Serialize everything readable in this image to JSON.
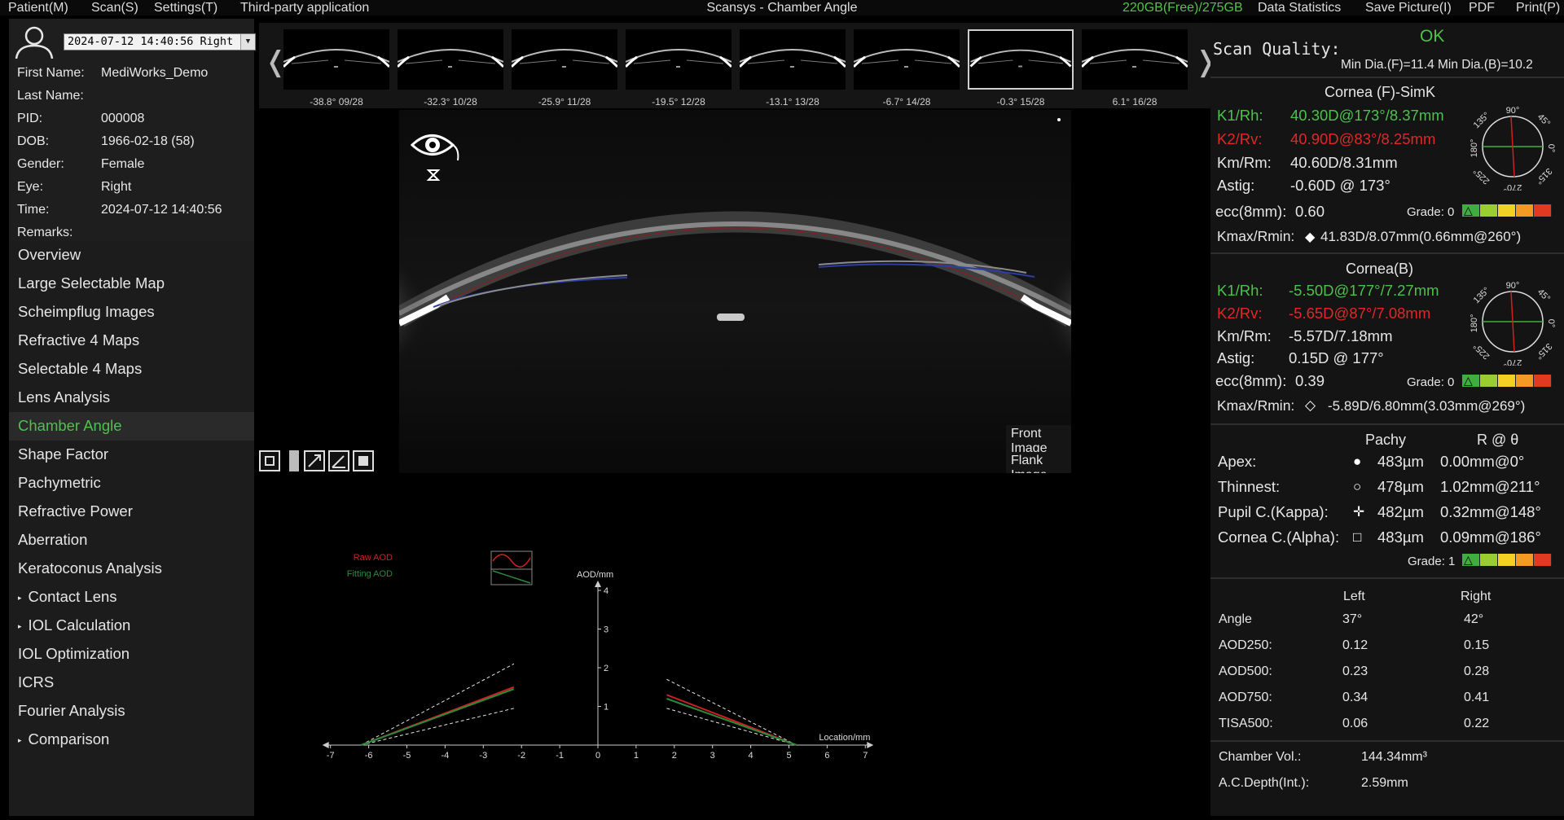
{
  "menu": {
    "patient": "Patient(M)",
    "scan": "Scan(S)",
    "settings": "Settings(T)",
    "third_party": "Third-party application",
    "window_title": "Scansys - Chamber Angle",
    "disk": "220GB(Free)/275GB",
    "data_statistics": "Data Statistics",
    "save_picture": "Save Picture(I)",
    "pdf": "PDF",
    "print": "Print(P)"
  },
  "patient": {
    "scan_select": "2024-07-12 14:40:56 Right",
    "rows": [
      {
        "label": "First Name:",
        "value": "MediWorks_Demo"
      },
      {
        "label": "Last Name:",
        "value": ""
      },
      {
        "label": "PID:",
        "value": "000008"
      },
      {
        "label": "DOB:",
        "value": "1966-02-18  (58)"
      },
      {
        "label": "Gender:",
        "value": "Female"
      },
      {
        "label": "Eye:",
        "value": "Right"
      },
      {
        "label": "Time:",
        "value": "2024-07-12 14:40:56"
      },
      {
        "label": "Remarks:",
        "value": ""
      }
    ]
  },
  "nav": [
    {
      "label": "Overview",
      "sub": false,
      "active": false
    },
    {
      "label": "Large Selectable Map",
      "sub": false,
      "active": false
    },
    {
      "label": "Scheimpflug Images",
      "sub": false,
      "active": false
    },
    {
      "label": "Refractive 4 Maps",
      "sub": false,
      "active": false
    },
    {
      "label": "Selectable 4 Maps",
      "sub": false,
      "active": false
    },
    {
      "label": "Lens Analysis",
      "sub": false,
      "active": false
    },
    {
      "label": "Chamber Angle",
      "sub": false,
      "active": true
    },
    {
      "label": "Shape Factor",
      "sub": false,
      "active": false
    },
    {
      "label": "Pachymetric",
      "sub": false,
      "active": false
    },
    {
      "label": "Refractive Power",
      "sub": false,
      "active": false
    },
    {
      "label": "Aberration",
      "sub": false,
      "active": false
    },
    {
      "label": "Keratoconus Analysis",
      "sub": false,
      "active": false
    },
    {
      "label": "Contact Lens",
      "sub": true,
      "active": false
    },
    {
      "label": "IOL Calculation",
      "sub": true,
      "active": false
    },
    {
      "label": "IOL Optimization",
      "sub": false,
      "active": false
    },
    {
      "label": "ICRS",
      "sub": false,
      "active": false
    },
    {
      "label": "Fourier Analysis",
      "sub": false,
      "active": false
    },
    {
      "label": "Comparison",
      "sub": true,
      "active": false
    }
  ],
  "thumbnails": [
    {
      "label": "-38.8° 09/28",
      "selected": false
    },
    {
      "label": "-32.3° 10/28",
      "selected": false
    },
    {
      "label": "-25.9° 11/28",
      "selected": false
    },
    {
      "label": "-19.5° 12/28",
      "selected": false
    },
    {
      "label": "-13.1° 13/28",
      "selected": false
    },
    {
      "label": "-6.7°  14/28",
      "selected": false
    },
    {
      "label": "-0.3°  15/28",
      "selected": true
    },
    {
      "label": "6.1°   16/28",
      "selected": false
    }
  ],
  "image": {
    "front_image": "Front Image",
    "flank_image": "Flank Image",
    "front_selected": false,
    "flank_selected": true
  },
  "chart_data": {
    "type": "line",
    "ylabel": "AOD/mm",
    "xlabel": "Location/mm",
    "xlim": [
      -7,
      7
    ],
    "ylim": [
      0,
      4
    ],
    "x_ticks": [
      "-7",
      "-6",
      "-5",
      "-4",
      "-3",
      "-2",
      "-1",
      "0",
      "1",
      "2",
      "3",
      "4",
      "5",
      "6",
      "7"
    ],
    "y_ticks": [
      "1",
      "2",
      "3",
      "4"
    ],
    "legend": [
      {
        "name": "Raw AOD",
        "color": "#d02020"
      },
      {
        "name": "Fitting AOD",
        "color": "#2a8a3a"
      }
    ],
    "series": [
      {
        "name": "Raw AOD",
        "side": "left",
        "x": [
          -6.2,
          -2.2
        ],
        "y": [
          0.0,
          1.5
        ]
      },
      {
        "name": "Fitting AOD",
        "side": "left",
        "x": [
          -6.2,
          -2.2
        ],
        "y": [
          0.0,
          1.45
        ]
      },
      {
        "name": "Raw AOD",
        "side": "right",
        "x": [
          1.8,
          5.2
        ],
        "y": [
          1.3,
          0.0
        ]
      },
      {
        "name": "Fitting AOD",
        "side": "right",
        "x": [
          1.8,
          5.2
        ],
        "y": [
          1.2,
          0.0
        ]
      }
    ],
    "bounds": [
      {
        "side": "left",
        "x": [
          -6.2,
          -2.2
        ],
        "y_upper": [
          0.0,
          2.1
        ],
        "y_lower": [
          0.0,
          0.95
        ]
      },
      {
        "side": "right",
        "x": [
          1.8,
          5.2
        ],
        "y_upper": [
          1.7,
          0.0
        ],
        "y_lower": [
          0.95,
          0.0
        ]
      }
    ]
  },
  "right": {
    "scan_quality_label": "Scan Quality:",
    "scan_quality_value": "OK",
    "min_dia": "Min Dia.(F)=11.4  Min Dia.(B)=10.2",
    "cornea_f_title": "Cornea (F)-SimK",
    "cornea_f": {
      "k1_label": "K1/Rh:",
      "k1": "40.30D@173°/8.37mm",
      "k2_label": "K2/Rv:",
      "k2": "40.90D@83°/8.25mm",
      "km_label": "Km/Rm:",
      "km": "40.60D/8.31mm",
      "astig_label": "Astig:",
      "astig": "-0.60D @ 173°",
      "ecc_label": "ecc(8mm):",
      "ecc": "0.60",
      "grade": "Grade: 0",
      "kmax_label": "Kmax/Rmin:",
      "kmax": "41.83D/8.07mm(0.66mm@260°)"
    },
    "cornea_b_title": "Cornea(B)",
    "cornea_b": {
      "k1_label": "K1/Rh:",
      "k1": "-5.50D@177°/7.27mm",
      "k2_label": "K2/Rv:",
      "k2": "-5.65D@87°/7.08mm",
      "km_label": "Km/Rm:",
      "km": "-5.57D/7.18mm",
      "astig_label": "Astig:",
      "astig": "0.15D @ 177°",
      "ecc_label": "ecc(8mm):",
      "ecc": "0.39",
      "grade": "Grade: 0",
      "kmax_label": "Kmax/Rmin:",
      "kmax": "-5.89D/6.80mm(3.03mm@269°)"
    },
    "dial_labels": {
      "d90": "90°",
      "d45": "45°",
      "d0": "0°",
      "d315": "315°",
      "d270": "270°",
      "d225": "225°",
      "d180": "180°",
      "d135": "135°"
    },
    "pachy_header": "Pachy",
    "r_header": "R @ θ",
    "pachy_rows": [
      {
        "label": "Apex:",
        "pachy": "483µm",
        "r": "0.00mm@0°",
        "symbol": "dot"
      },
      {
        "label": "Thinnest:",
        "pachy": "478µm",
        "r": "1.02mm@211°",
        "symbol": "circle"
      },
      {
        "label": "Pupil C.(Kappa):",
        "pachy": "482µm",
        "r": "0.32mm@148°",
        "symbol": "cross"
      },
      {
        "label": "Cornea C.(Alpha):",
        "pachy": "483µm",
        "r": "0.09mm@186°",
        "symbol": "square"
      }
    ],
    "pachy_grade": "Grade: 1",
    "angle_header_left": "Left",
    "angle_header_right": "Right",
    "angle_rows": [
      {
        "label": "Angle",
        "left": "37°",
        "right": "42°"
      },
      {
        "label": "AOD250:",
        "left": "0.12",
        "right": "0.15"
      },
      {
        "label": "AOD500:",
        "left": "0.23",
        "right": "0.28"
      },
      {
        "label": "AOD750:",
        "left": "0.34",
        "right": "0.41"
      },
      {
        "label": "TISA500:",
        "left": "0.06",
        "right": "0.22"
      }
    ],
    "chamber_vol_label": "Chamber Vol.:",
    "chamber_vol": "144.34mm³",
    "ac_depth_label": "A.C.Depth(Int.):",
    "ac_depth": "2.59mm",
    "grade_colors": [
      "#3fae3f",
      "#9acd32",
      "#f2d024",
      "#f29a24",
      "#e03a20"
    ]
  }
}
